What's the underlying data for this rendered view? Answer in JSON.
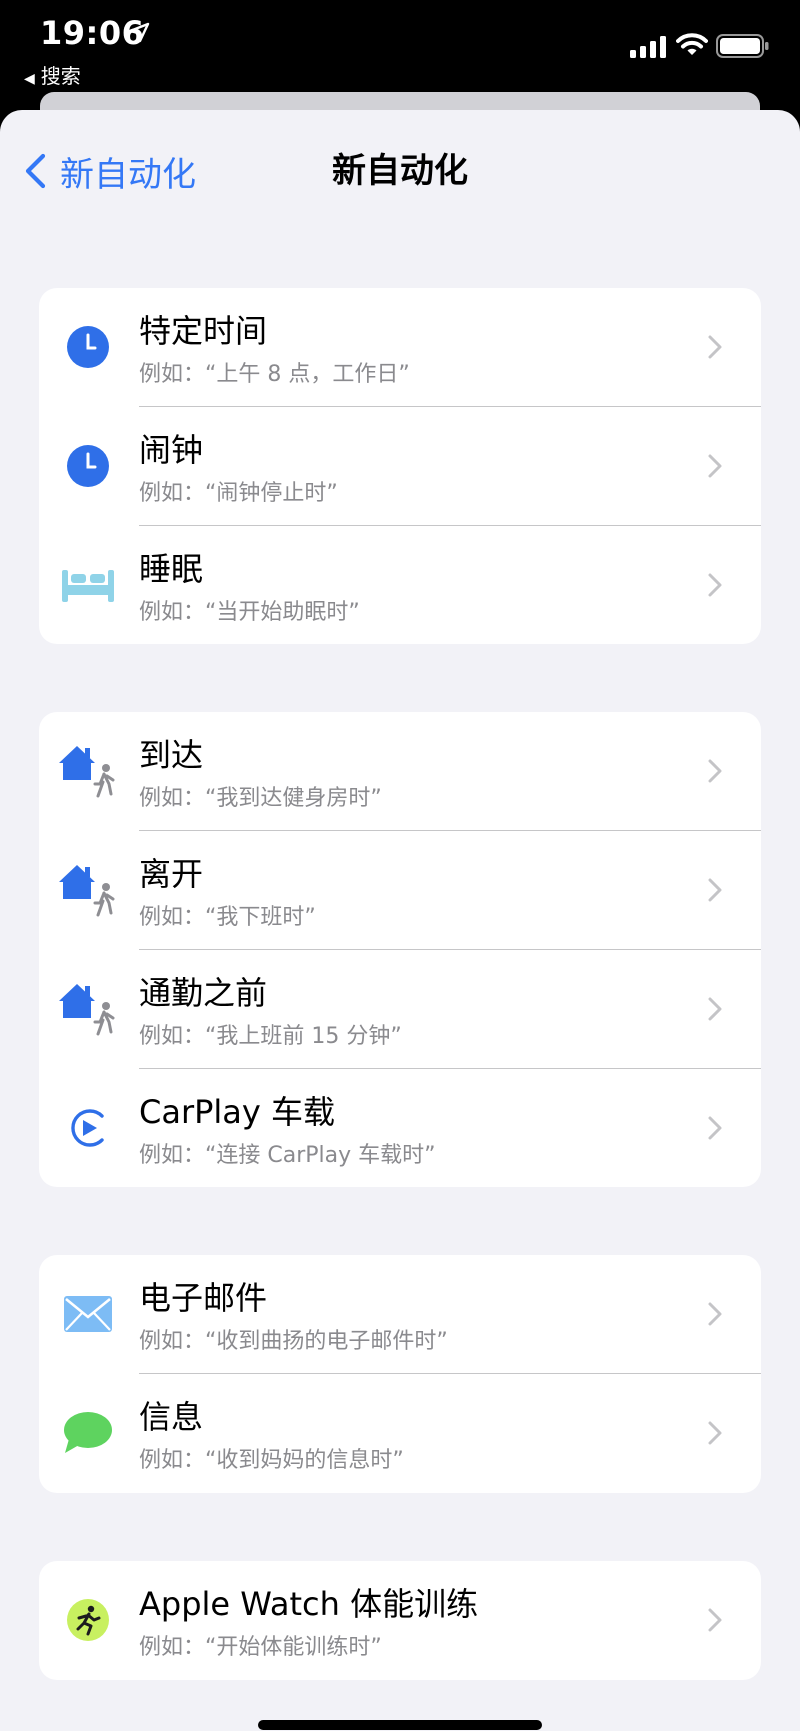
{
  "status": {
    "time": "19:06",
    "back_app": "搜索"
  },
  "nav": {
    "back_label": "新自动化",
    "title": "新自动化"
  },
  "groups": [
    {
      "items": [
        {
          "title": "特定时间",
          "subtitle": "例如：“上午 8 点，工作日”",
          "icon": "clock-icon"
        },
        {
          "title": "闹钟",
          "subtitle": "例如：“闹钟停止时”",
          "icon": "clock-icon"
        },
        {
          "title": "睡眠",
          "subtitle": "例如：“当开始助眠时”",
          "icon": "bed-icon"
        }
      ]
    },
    {
      "items": [
        {
          "title": "到达",
          "subtitle": "例如：“我到达健身房时”",
          "icon": "home-person-icon"
        },
        {
          "title": "离开",
          "subtitle": "例如：“我下班时”",
          "icon": "home-person-icon"
        },
        {
          "title": "通勤之前",
          "subtitle": "例如：“我上班前 15 分钟”",
          "icon": "home-person-icon"
        },
        {
          "title": "CarPlay 车载",
          "subtitle": "例如：“连接 CarPlay 车载时”",
          "icon": "carplay-icon"
        }
      ]
    },
    {
      "items": [
        {
          "title": "电子邮件",
          "subtitle": "例如：“收到曲扬的电子邮件时”",
          "icon": "mail-icon"
        },
        {
          "title": "信息",
          "subtitle": "例如：“收到妈妈的信息时”",
          "icon": "message-icon"
        }
      ]
    },
    {
      "items": [
        {
          "title": "Apple Watch 体能训练",
          "subtitle": "例如：“开始体能训练时”",
          "icon": "workout-icon"
        }
      ]
    }
  ],
  "colors": {
    "accent": "#3478f6",
    "icon_blue": "#2f6fe8",
    "bed": "#8fd3e8",
    "mail": "#7dbcf5",
    "message": "#5ed35f",
    "workout": "#c8f060",
    "subtitle": "#8a8a8e",
    "background": "#f2f2f7"
  }
}
